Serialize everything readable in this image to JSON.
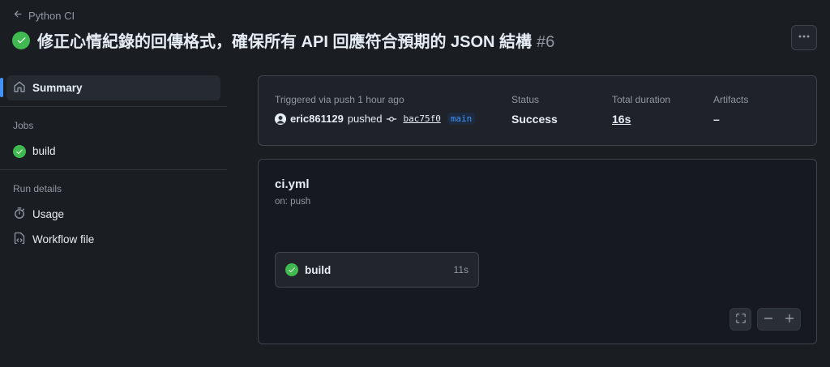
{
  "header": {
    "back_label": "Python CI",
    "title": "修正心情紀錄的回傳格式，確保所有 API 回應符合預期的 JSON 結構",
    "run_number": "#6"
  },
  "sidebar": {
    "summary_label": "Summary",
    "jobs_heading": "Jobs",
    "jobs": [
      {
        "label": "build"
      }
    ],
    "run_details_heading": "Run details",
    "usage_label": "Usage",
    "workflow_file_label": "Workflow file"
  },
  "summary": {
    "trigger_text": "Triggered via push 1 hour ago",
    "actor": "eric861129",
    "action": "pushed",
    "commit_sha": "bac75f0",
    "branch": "main",
    "status_label": "Status",
    "status_value": "Success",
    "duration_label": "Total duration",
    "duration_value": "16s",
    "artifacts_label": "Artifacts",
    "artifacts_value": "–"
  },
  "workflow": {
    "file_name": "ci.yml",
    "trigger": "on: push",
    "job": {
      "name": "build",
      "duration": "11s"
    }
  },
  "icons": {
    "back": "arrow-left-icon",
    "status": "check-circle-icon",
    "more": "kebab-horizontal-icon",
    "summary": "home-icon",
    "usage": "stopwatch-icon",
    "workflow_file": "file-code-icon",
    "commit": "git-commit-icon",
    "fullscreen": "screen-full-icon",
    "zoom_out": "minus-icon",
    "zoom_in": "plus-icon"
  },
  "colors": {
    "success": "#3fb950",
    "accent": "#4493f8",
    "background": "#1a1d22"
  }
}
